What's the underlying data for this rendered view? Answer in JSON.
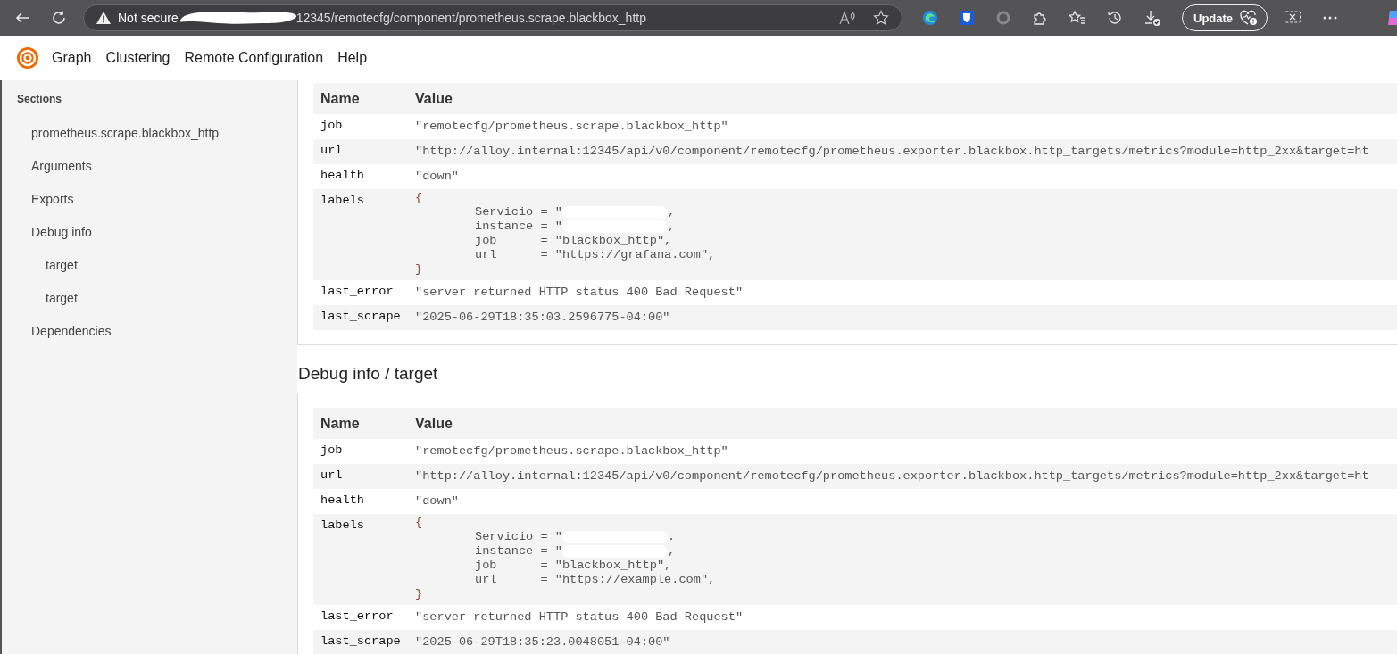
{
  "browser": {
    "security": "Not secure",
    "address": "12345/remotecfg/component/prometheus.scrape.blackbox_http",
    "update_button": "Update"
  },
  "nav": {
    "items": [
      "Graph",
      "Clustering",
      "Remote Configuration",
      "Help"
    ]
  },
  "sidebar": {
    "title": "Sections",
    "items": [
      {
        "label": "prometheus.scrape.blackbox_http"
      },
      {
        "label": "Arguments"
      },
      {
        "label": "Exports"
      },
      {
        "label": "Debug info",
        "children": [
          {
            "label": "target"
          },
          {
            "label": "target"
          }
        ]
      },
      {
        "label": "Dependencies"
      }
    ]
  },
  "sections": [
    {
      "table": {
        "columns": [
          "Name",
          "Value"
        ],
        "rows": [
          {
            "kind": "text",
            "name": "job",
            "value": "\"remotecfg/prometheus.scrape.blackbox_http\""
          },
          {
            "kind": "text",
            "name": "url",
            "value": "\"http://alloy.internal:12345/api/v0/component/remotecfg/prometheus.exporter.blackbox.http_targets/metrics?module=http_2xx&target=ht"
          },
          {
            "kind": "text",
            "name": "health",
            "value": "\"down\""
          },
          {
            "kind": "labels",
            "name": "labels",
            "open": "{",
            "close": "}",
            "lines": [
              {
                "text": "Servicio = \"",
                "redacted": true,
                "tail": ","
              },
              {
                "text": "instance = \"",
                "redacted": true,
                "tail": ","
              },
              {
                "text": "job      = \"blackbox_http\",",
                "redacted": false
              },
              {
                "text": "url      = \"https://grafana.com\",",
                "redacted": false
              }
            ]
          },
          {
            "kind": "text",
            "name": "last_error",
            "value": "\"server returned HTTP status 400 Bad Request\""
          },
          {
            "kind": "text",
            "name": "last_scrape",
            "value": "\"2025-06-29T18:35:03.2596775-04:00\""
          }
        ]
      }
    },
    {
      "title": "Debug info / target",
      "table": {
        "columns": [
          "Name",
          "Value"
        ],
        "rows": [
          {
            "kind": "text",
            "name": "job",
            "value": "\"remotecfg/prometheus.scrape.blackbox_http\""
          },
          {
            "kind": "text",
            "name": "url",
            "value": "\"http://alloy.internal:12345/api/v0/component/remotecfg/prometheus.exporter.blackbox.http_targets/metrics?module=http_2xx&target=ht"
          },
          {
            "kind": "text",
            "name": "health",
            "value": "\"down\""
          },
          {
            "kind": "labels",
            "name": "labels",
            "open": "{",
            "close": "}",
            "lines": [
              {
                "text": "Servicio = \"",
                "redacted": true,
                "tail": "."
              },
              {
                "text": "instance = \"",
                "redacted": true,
                "tail": ","
              },
              {
                "text": "job      = \"blackbox_http\",",
                "redacted": false
              },
              {
                "text": "url      = \"https://example.com\",",
                "redacted": false
              }
            ]
          },
          {
            "kind": "text",
            "name": "last_error",
            "value": "\"server returned HTTP status 400 Bad Request\""
          },
          {
            "kind": "text",
            "name": "last_scrape",
            "value": "\"2025-06-29T18:35:23.0048051-04:00\""
          }
        ]
      }
    }
  ]
}
